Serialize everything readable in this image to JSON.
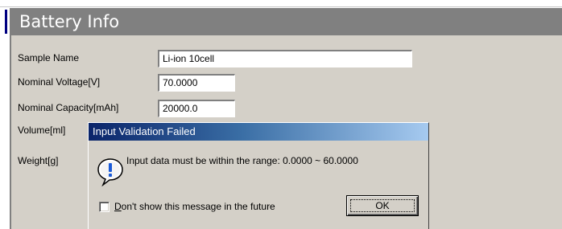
{
  "window": {
    "title": "Battery Info"
  },
  "form": {
    "sample_name": {
      "label": "Sample Name",
      "value": "Li-ion 10cell"
    },
    "nominal_voltage": {
      "label": "Nominal Voltage[V]",
      "value": "70.0000"
    },
    "nominal_capacity": {
      "label": "Nominal Capacity[mAh]",
      "value": "20000.0"
    },
    "volume": {
      "label": "Volume[ml]"
    },
    "weight": {
      "label": "Weight[g]"
    }
  },
  "dialog": {
    "title": "Input Validation Failed",
    "message": "Input data must be within the range: 0.0000 ~ 60.0000",
    "icon": "info-icon",
    "checkbox_label_hotkey": "D",
    "checkbox_label_rest": "on't show this message in the future",
    "checkbox_checked": false,
    "ok_label": "OK"
  },
  "colors": {
    "title_gray": "#808080",
    "dialog_title_start": "#0a246a",
    "dialog_title_end": "#a6caf0",
    "face": "#d4d0c8"
  }
}
